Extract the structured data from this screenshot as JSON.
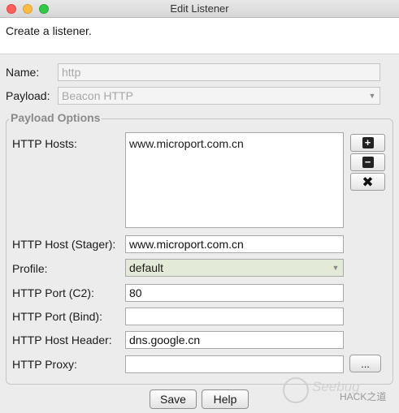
{
  "window": {
    "title": "Edit Listener"
  },
  "header": {
    "description": "Create a listener."
  },
  "form": {
    "name_label": "Name:",
    "name_value": "http",
    "payload_label": "Payload:",
    "payload_value": "Beacon HTTP"
  },
  "payload_options": {
    "title": "Payload Options",
    "hosts_label": "HTTP Hosts:",
    "hosts": [
      "www.microport.com.cn"
    ],
    "host_stager_label": "HTTP Host (Stager):",
    "host_stager_value": "www.microport.com.cn",
    "profile_label": "Profile:",
    "profile_value": "default",
    "port_c2_label": "HTTP Port (C2):",
    "port_c2_value": "80",
    "port_bind_label": "HTTP Port (Bind):",
    "port_bind_value": "",
    "host_header_label": "HTTP Host Header:",
    "host_header_value": "dns.google.cn",
    "proxy_label": "HTTP Proxy:",
    "proxy_value": "",
    "proxy_button_label": "...",
    "add_symbol": "+",
    "remove_symbol": "−",
    "clear_symbol": "✖"
  },
  "buttons": {
    "save": "Save",
    "help": "Help"
  },
  "watermark": {
    "brand": "Seebug",
    "text": "HACK之道"
  },
  "icons": {
    "add": "plus-icon",
    "remove": "minus-icon",
    "clear": "x-icon"
  }
}
